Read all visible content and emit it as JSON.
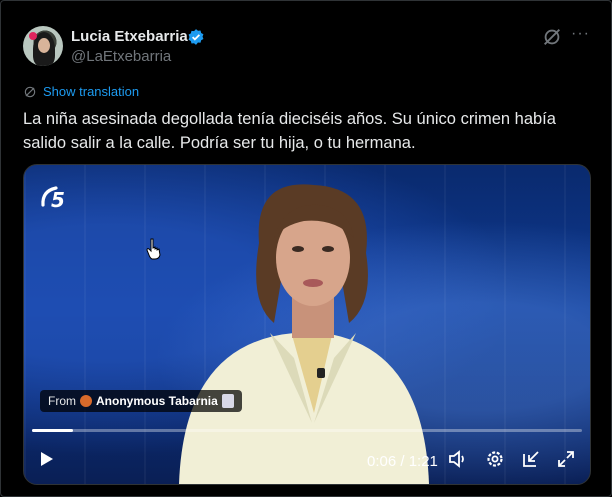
{
  "tweet": {
    "author_name": "Lucia Etxebarria",
    "handle": "@LaEtxebarria",
    "translate_label": "Show translation",
    "text": "La niña asesinada degollada tenía dieciséis años. Su único crimen había salido salir a la calle. Podría ser tu hija, o tu hermana."
  },
  "video": {
    "from_prefix": "From",
    "from_name": "Anonymous Tabarnia",
    "current_time": "0:06",
    "duration": "1:21",
    "time_display": "0:06 / 1:21",
    "progress_fraction": 0.074
  },
  "icons": {
    "verified": "verified-badge-icon",
    "grok": "grok-icon",
    "more": "more-icon",
    "translate": "translate-icon",
    "channel_logo": "telecinco-logo",
    "play": "play-icon",
    "volume": "volume-icon",
    "settings": "gear-icon",
    "pip": "picture-in-picture-icon",
    "fullscreen": "fullscreen-icon"
  },
  "colors": {
    "accent": "#1d9bf0",
    "background": "#000000",
    "secondary_text": "#71767b"
  }
}
